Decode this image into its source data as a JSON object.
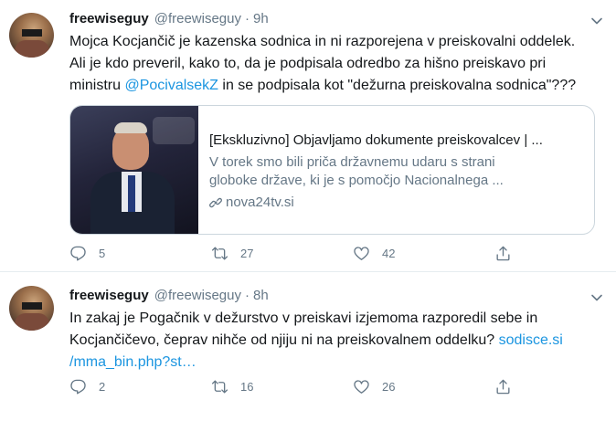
{
  "tweets": [
    {
      "name": "freewiseguy",
      "handle": "@freewiseguy",
      "separator": "·",
      "time": "9h",
      "text_lines": [
        "Mojca Kocjančič je kazenska sodnica in ni razporejena v preiskovalni oddelek.",
        "Ali je kdo preveril, kako to, da je podpisala odredbo za hišno preiskavo pri"
      ],
      "text_line3_pre": "ministru ",
      "text_mention": "@PocivalsekZ",
      "text_line3_post": " in se podpisala kot \"dežurna preiskovalna sodnica\"???",
      "card": {
        "title": "[Ekskluzivno] Objavljamo dokumente preiskovalcev | ...",
        "desc_line1": "V torek smo bili priča državnemu udaru s strani",
        "desc_line2": "globoke države, ki je s pomočjo Nacionalnega ...",
        "domain": "nova24tv.si"
      },
      "replies": "5",
      "retweets": "27",
      "likes": "42"
    },
    {
      "name": "freewiseguy",
      "handle": "@freewiseguy",
      "separator": "·",
      "time": "8h",
      "text_line1": "In zakaj je Pogačnik v dežurstvo v preiskavi izjemoma razporedil sebe in",
      "text_line2_pre": "Kocjančičevo, čeprav nihče od njiju ni na preiskovalnem oddelku? ",
      "text_link1": "sodisce.si",
      "text_link2": "/mma_bin.php?st…",
      "replies": "2",
      "retweets": "16",
      "likes": "26"
    }
  ],
  "colors": {
    "text": "#14171a",
    "secondary": "#657786",
    "link": "#1b95e0",
    "border": "#ccd6dd",
    "divider": "#e6ecf0"
  },
  "icons": [
    "reply-icon",
    "retweet-icon",
    "like-icon",
    "share-icon",
    "chevron-down-icon",
    "link-icon"
  ]
}
